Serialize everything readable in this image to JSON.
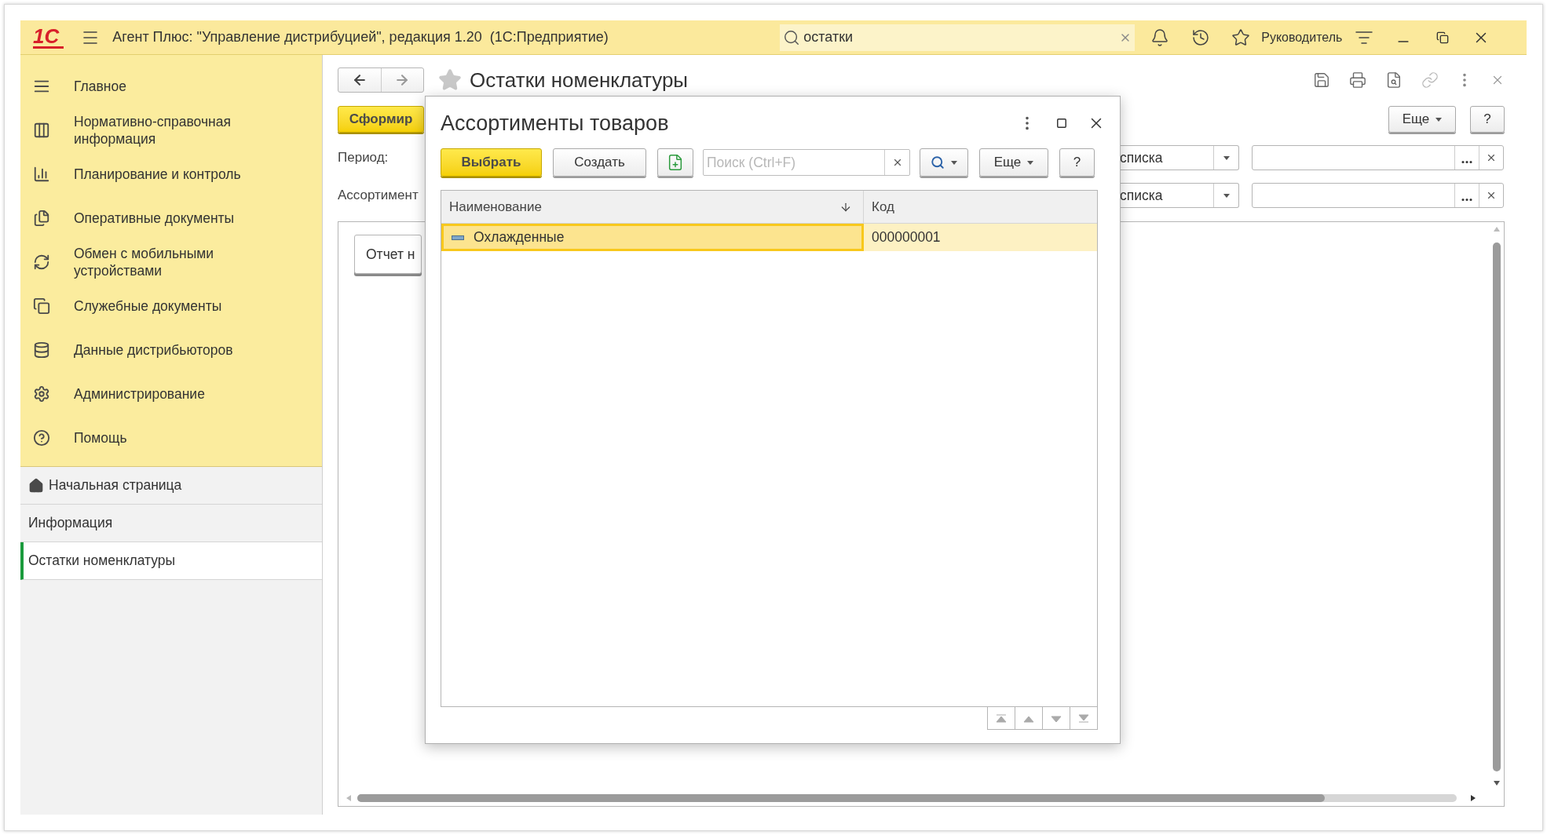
{
  "app_bar": {
    "logo": "1С",
    "title": "Агент Плюс: \"Управление дистрибуцией\", редакция 1.20  (1С:Предприятие)",
    "search": {
      "value": "остатки"
    },
    "user": "Руководитель"
  },
  "sidebar": {
    "sections": [
      {
        "label": "Главное"
      },
      {
        "label": "Нормативно-справочная информация"
      },
      {
        "label": "Планирование и контроль"
      },
      {
        "label": "Оперативные документы"
      },
      {
        "label": "Обмен с мобильными устройствами"
      },
      {
        "label": "Служебные документы"
      },
      {
        "label": "Данные дистрибьюторов"
      },
      {
        "label": "Администрирование"
      },
      {
        "label": "Помощь"
      }
    ],
    "open_windows": [
      {
        "label": "Начальная страница",
        "kind": "home",
        "selected": false
      },
      {
        "label": "Информация",
        "kind": "plain",
        "selected": false
      },
      {
        "label": "Остатки номенклатуры",
        "kind": "plain",
        "selected": true
      }
    ]
  },
  "form": {
    "title": "Остатки номенклатуры",
    "generate_button": "Сформир",
    "more_button": "Еще",
    "help_button": "?",
    "fields": [
      {
        "label": "Период:",
        "value": "списка"
      },
      {
        "label": "Ассортимент",
        "value": "списка"
      }
    ],
    "report_button": "Отчет н"
  },
  "dialog": {
    "title": "Ассортименты товаров",
    "select_button": "Выбрать",
    "create_button": "Создать",
    "search": {
      "placeholder": "Поиск (Ctrl+F)"
    },
    "more_button": "Еще",
    "help_button": "?",
    "table": {
      "columns": [
        "Наименование",
        "Код"
      ],
      "rows": [
        {
          "name": "Охлажденные",
          "code": "000000001",
          "selected": true
        }
      ]
    }
  }
}
